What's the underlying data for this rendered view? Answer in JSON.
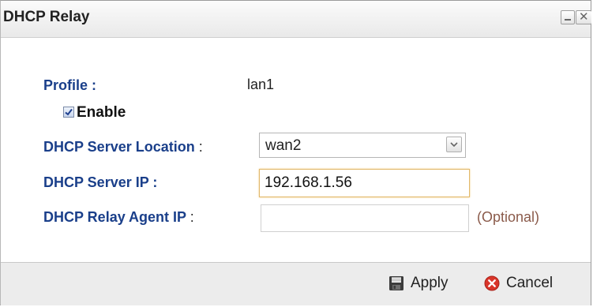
{
  "window": {
    "title": "DHCP Relay",
    "controls": {
      "minimize": "minimize-icon",
      "close": "close-icon"
    }
  },
  "form": {
    "profile_label": "Profile :",
    "profile_value": "lan1",
    "enable_label": "Enable",
    "enable_checked": true,
    "server_location_label": "DHCP Server Location",
    "server_location_colon": ":",
    "server_location_value": "wan2",
    "server_ip_label": "DHCP Server IP :",
    "server_ip_value": "192.168.1.56",
    "relay_agent_label": "DHCP Relay Agent IP",
    "relay_agent_colon": ":",
    "relay_agent_value": "",
    "optional_text": "(Optional)"
  },
  "footer": {
    "apply_label": "Apply",
    "cancel_label": "Cancel",
    "apply_icon": "save-icon",
    "cancel_icon": "cancel-icon"
  },
  "colors": {
    "label_blue": "#1a3f8a",
    "focus_border": "#e2b86a",
    "optional_text": "#8a5a4a",
    "cancel_red": "#d9352a"
  }
}
